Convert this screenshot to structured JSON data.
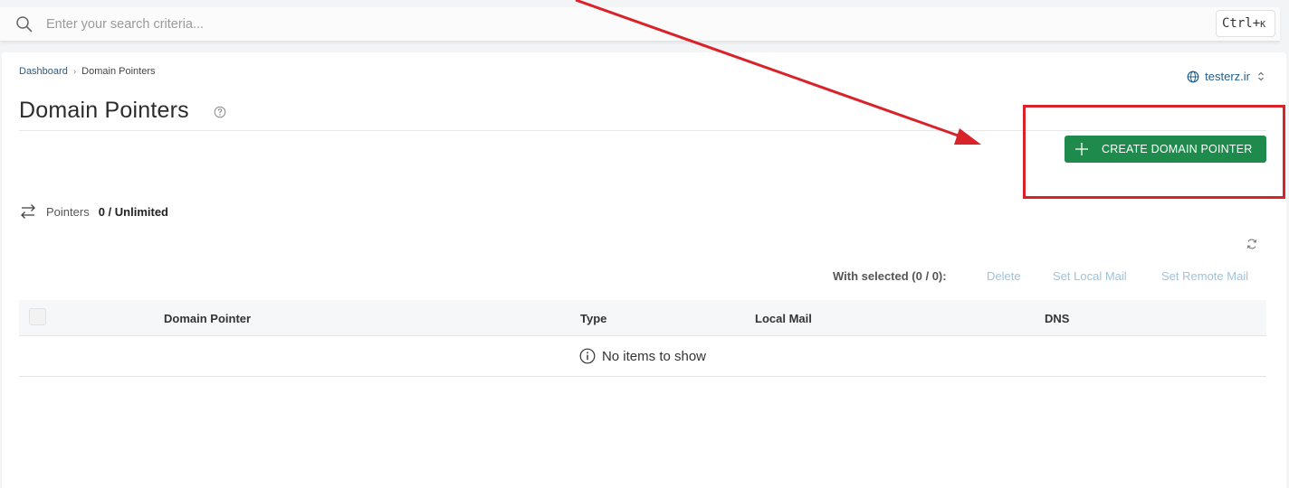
{
  "search": {
    "placeholder": "Enter your search criteria...",
    "shortcut": "Ctrl+",
    "shortcut_key": "K"
  },
  "breadcrumb": {
    "items": [
      "Dashboard",
      "Domain Pointers"
    ]
  },
  "domain_selector": {
    "value": "testerz.ir"
  },
  "page": {
    "title": "Domain Pointers"
  },
  "toolbar": {
    "create_label": "CREATE DOMAIN POINTER"
  },
  "usage": {
    "label": "Pointers",
    "value": "0 / Unlimited"
  },
  "bulk": {
    "label": "With selected (0 / 0):",
    "actions": [
      "Delete",
      "Set Local Mail",
      "Set Remote Mail"
    ]
  },
  "table": {
    "columns": [
      "Domain Pointer",
      "Type",
      "Local Mail",
      "DNS"
    ],
    "empty_text": "No items to show"
  },
  "colors": {
    "primary_button": "#1e8a4c",
    "link": "#1f5e8c",
    "disabled_action": "#9fc3db",
    "annotation": "#d9232b"
  }
}
